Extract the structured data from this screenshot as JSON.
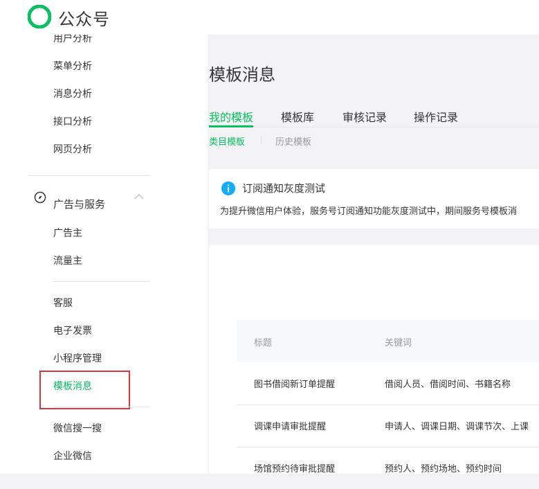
{
  "header": {
    "brand": "公众号"
  },
  "sidebar": {
    "items_top": [
      "用户分析",
      "菜单分析",
      "消息分析",
      "接口分析",
      "网页分析"
    ],
    "group": {
      "label": "广告与服务"
    },
    "group_items": [
      "广告主",
      "流量主"
    ],
    "items_bottom": [
      "客服",
      "电子发票",
      "小程序管理",
      "模板消息"
    ],
    "items_end": [
      "微信搜一搜",
      "企业微信"
    ],
    "active_item": "模板消息"
  },
  "main": {
    "title": "模板消息",
    "tabs": [
      "我的模板",
      "模板库",
      "审核记录",
      "操作记录"
    ],
    "active_tab": "我的模板",
    "subtabs": [
      "类目模板",
      "历史模板"
    ],
    "notice": {
      "title": "订阅通知灰度测试",
      "text": "为提升微信用户体验，服务号订阅通知功能灰度测试中，期间服务号模板消"
    },
    "table": {
      "headers": [
        "标题",
        "关键词"
      ],
      "rows": [
        [
          "图书借阅新订单提醒",
          "借阅人员、借阅时间、书籍名称"
        ],
        [
          "调课申请审批提醒",
          "申请人、调课日期、调课节次、上课"
        ],
        [
          "场馆预约待审批提醒",
          "预约人、预约场地、预约时间"
        ]
      ]
    }
  },
  "colors": {
    "accent": "#07c160",
    "info": "#10aeff",
    "highlight_border": "#d9363e"
  }
}
